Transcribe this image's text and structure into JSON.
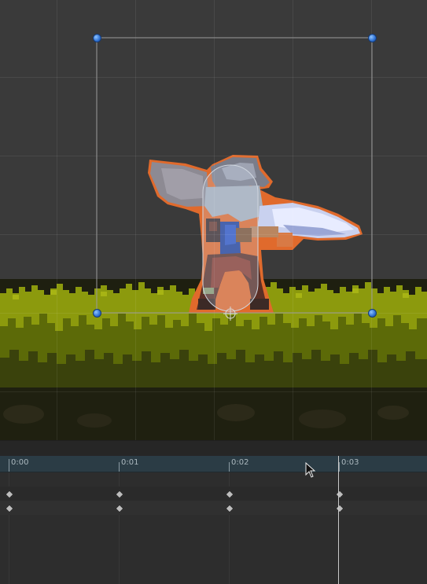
{
  "timeline": {
    "ticks": [
      "0:00",
      "0:01",
      "0:02",
      "0:03"
    ]
  },
  "icons": {
    "pointer": "mouse-pointer-icon",
    "pivot": "pivot-crosshair-icon",
    "keyframe": "diamond-keyframe-icon"
  },
  "colors": {
    "scene_background": "#3a3a3a",
    "selection_outline": "#e06a2c",
    "handle": "#3b82e6",
    "grass": "#8a9a0c",
    "timeline_ruler": "#2b3c45"
  }
}
